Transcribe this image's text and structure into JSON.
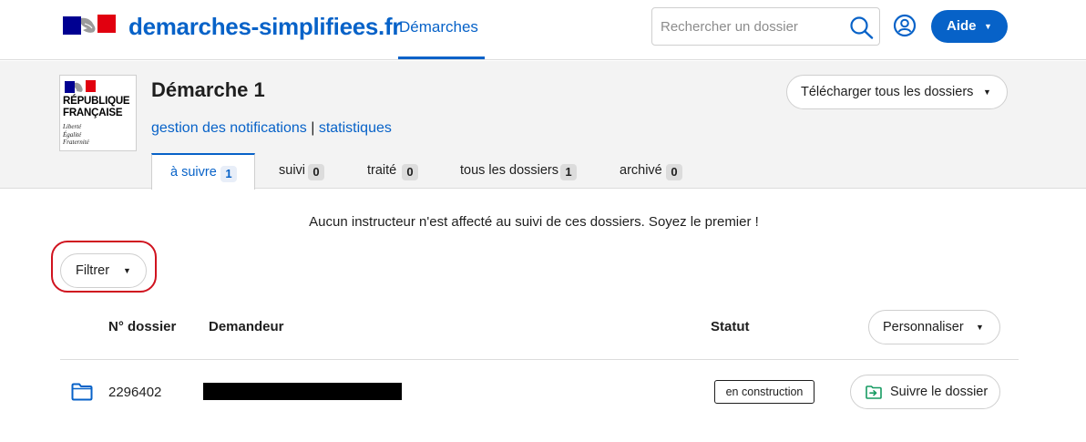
{
  "header": {
    "brand": "demarches-simplifiees.fr",
    "nav_demarches": "Démarches",
    "search_placeholder": "Rechercher un dossier",
    "help_label": "Aide"
  },
  "procedure": {
    "logo_line1": "RÉPUBLIQUE",
    "logo_line2": "FRANÇAISE",
    "logo_motto": [
      "Liberté",
      "Égalité",
      "Fraternité"
    ],
    "title": "Démarche 1",
    "link_notifications": "gestion des notifications",
    "link_separator": " | ",
    "link_stats": "statistiques",
    "download_label": "Télécharger tous les dossiers",
    "tabs": [
      {
        "label": "à suivre",
        "count": "1"
      },
      {
        "label": "suivi",
        "count": "0"
      },
      {
        "label": "traité",
        "count": "0"
      },
      {
        "label": "tous les dossiers",
        "count": "1"
      },
      {
        "label": "archivé",
        "count": "0"
      }
    ]
  },
  "main": {
    "notice": "Aucun instructeur n'est affecté au suivi de ces dossiers. Soyez le premier !",
    "filter_label": "Filtrer",
    "columns": {
      "number": "N° dossier",
      "applicant": "Demandeur",
      "status": "Statut"
    },
    "customize_label": "Personnaliser",
    "rows": [
      {
        "number": "2296402",
        "status": "en construction",
        "action": "Suivre le dossier"
      }
    ]
  },
  "colors": {
    "accent": "#0762c8",
    "highlight_ring": "#d0131f",
    "header_band": "#f3f3f3",
    "marianne_blue": "#000091",
    "marianne_red": "#e1000f"
  },
  "icons": {
    "search": "search-icon",
    "account": "account-icon",
    "folder": "folder-icon",
    "follow": "follow-icon"
  }
}
